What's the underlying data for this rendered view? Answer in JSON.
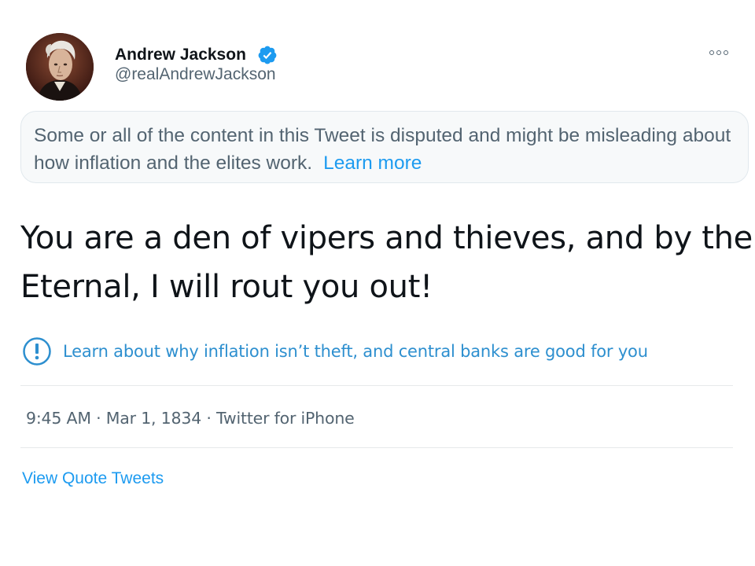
{
  "author": {
    "display_name": "Andrew Jackson",
    "handle": "@realAndrewJackson",
    "verified_icon": "verified-badge-icon",
    "avatar_icon": "portrait-avatar"
  },
  "more_icon": "more-options-icon",
  "notice": {
    "text": "Some or all of the content in this Tweet is disputed and might be misleading about how inflation and the elites work.",
    "link_label": "Learn more"
  },
  "tweet": {
    "text": "You are a den of vipers and thieves, and by the Eternal, I will rout you out!"
  },
  "info": {
    "icon": "exclamation-circle-icon",
    "link_label": "Learn about why inflation isn’t theft, and central banks are good for you"
  },
  "meta": {
    "text": "9:45 AM · Mar 1, 1834 · Twitter for iPhone"
  },
  "quote_tweets_label": "View Quote Tweets",
  "colors": {
    "accent": "#1d9bf0",
    "text_primary": "#0f1419",
    "text_secondary": "#536471"
  }
}
